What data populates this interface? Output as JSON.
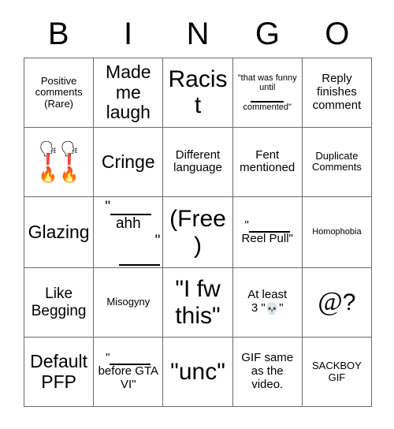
{
  "card": {
    "title_letters": [
      "B",
      "I",
      "N",
      "G",
      "O"
    ],
    "free_space_label": "(Free)"
  },
  "grid": {
    "rows": [
      [
        {
          "id": "b1",
          "text": "Positive comments (Rare)",
          "size": "sm"
        },
        {
          "id": "i1",
          "text": "Made me laugh",
          "size": "xl"
        },
        {
          "id": "n1",
          "text": "Racist",
          "size": "xxl"
        },
        {
          "id": "g1",
          "type": "fill-blank",
          "pre": "\"that was funny until",
          "post": "commented\"",
          "size": "xs"
        },
        {
          "id": "o1",
          "text": "Reply finishes comment",
          "size": "md"
        }
      ],
      [
        {
          "id": "b2",
          "type": "emoji",
          "emoji": [
            "🗣",
            "❗",
            "🔥"
          ],
          "repeat": 2,
          "size": "lg"
        },
        {
          "id": "i2",
          "text": "Cringe",
          "size": "xl"
        },
        {
          "id": "n2",
          "text": "Different language",
          "size": "md"
        },
        {
          "id": "g2",
          "text": "Fent mentioned",
          "size": "md"
        },
        {
          "id": "o2",
          "text": "Duplicate Comments",
          "size": "sm"
        }
      ],
      [
        {
          "id": "b3",
          "text": "Glazing",
          "size": "xl"
        },
        {
          "id": "i3",
          "type": "blank-word-blank",
          "open_quote": "\"",
          "word": "ahh",
          "close_quote": "\"",
          "size": "lg"
        },
        {
          "id": "n3",
          "text": "(Free)",
          "size": "xxl"
        },
        {
          "id": "g3",
          "type": "blank-before",
          "open_quote": "\"",
          "post": "Reel Pull\"",
          "size": "md"
        },
        {
          "id": "o3",
          "text": "Homophobia",
          "size": "xs"
        }
      ],
      [
        {
          "id": "b4",
          "text": "Like Begging",
          "size": "lg"
        },
        {
          "id": "i4",
          "text": "Misogyny",
          "size": "sm"
        },
        {
          "id": "n4",
          "text": "\"I fw this\"",
          "size": "xxl"
        },
        {
          "id": "g4",
          "type": "skull",
          "pre": "At least",
          "line2_pre": "3 \"",
          "emoji": "💀",
          "line2_post": "\"",
          "size": "md"
        },
        {
          "id": "o4",
          "type": "at",
          "at": "@",
          "q": "?",
          "size": "xxl"
        }
      ],
      [
        {
          "id": "b5",
          "text": "Default PFP",
          "size": "xl"
        },
        {
          "id": "i5",
          "type": "blank-before",
          "open_quote": "\"",
          "post": "before GTA VI\"",
          "size": "md"
        },
        {
          "id": "n5",
          "text": "\"unc\"",
          "size": "xxl"
        },
        {
          "id": "g5",
          "text": "GIF same as the video.",
          "size": "md"
        },
        {
          "id": "o5",
          "text": "SACKBOY GIF",
          "size": "sm"
        }
      ]
    ]
  },
  "colors": {
    "grid_line": "#6b6b6b",
    "text": "#000000",
    "background": "#ffffff",
    "emoji_head": "#1d7fd4",
    "emoji_exclaim": "#e8453c",
    "emoji_fire": "#f8a01d"
  }
}
